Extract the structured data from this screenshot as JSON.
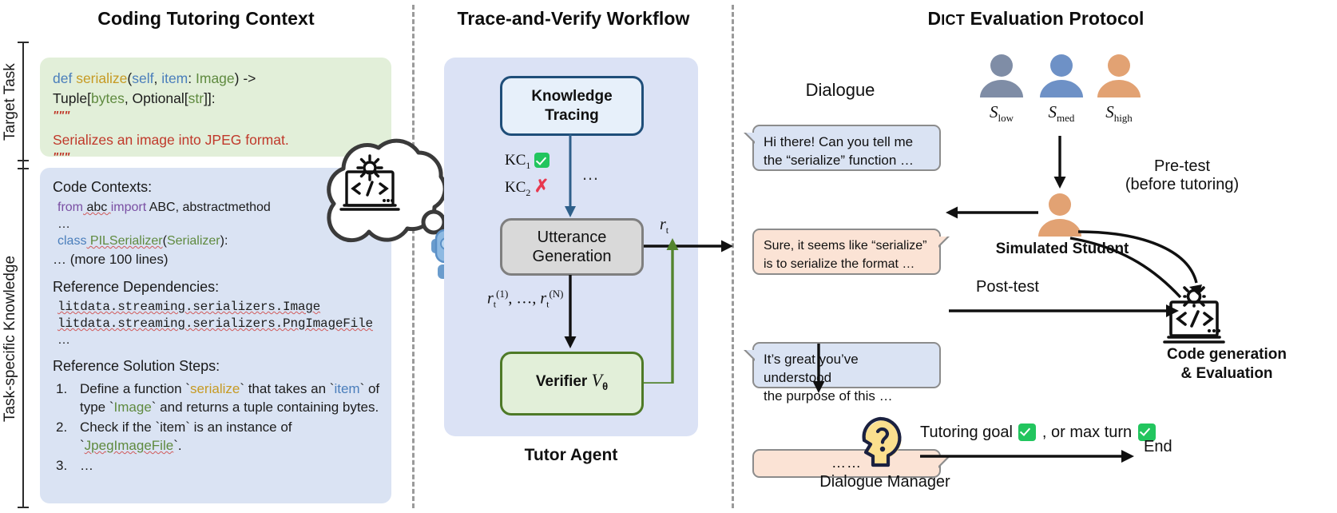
{
  "panels": {
    "left": {
      "title": "Coding Tutoring Context"
    },
    "middle": {
      "title": "Trace-and-Verify Workflow",
      "footer": "Tutor Agent"
    },
    "right": {
      "title_d": "D",
      "title_ict": "ICT",
      "title_rest": " Evaluation Protocol"
    }
  },
  "side_labels": {
    "target_task": "Target Task",
    "task_knowledge": "Task-specific Knowledge"
  },
  "target_task": {
    "line1": {
      "def": "def",
      "fn": "serialize",
      "p1": "(",
      "self": "self",
      "comma": ",  ",
      "item": "item",
      "colon": ": ",
      "image": "Image",
      "p2": ")  ->"
    },
    "line2": {
      "tuple": "Tuple[",
      "bytes": "bytes",
      "sep": ", Optional[",
      "str": "str",
      "end": "]]:"
    },
    "quote_open": "\"\"\"",
    "doc": "Serializes an image into JPEG format.",
    "quote_close": "\"\"\""
  },
  "knowledge": {
    "code_contexts_heading": "Code Contexts:",
    "code_lines": {
      "l1_from": "from",
      "l1_abc": " abc ",
      "l1_import": "import",
      "l1_rest": " ABC, abstractmethod",
      "l2": "…",
      "l3_class": "class",
      "l3_name": " PILSerializer",
      "l3_p1": "(",
      "l3_base": "Serializer",
      "l3_p2": "):",
      "l4": "… (more 100 lines)"
    },
    "ref_deps_heading": "Reference Dependencies:",
    "deps": [
      "litdata.streaming.serializers.Image",
      "litdata.streaming.serializers.PngImageFile",
      "…"
    ],
    "ref_steps_heading": "Reference Solution Steps:",
    "steps": [
      {
        "num": "1.",
        "a": "Define a function `",
        "code1": "serialize",
        "b": "` that takes an `",
        "code2": "item",
        "c": "` of",
        "line2a": "type `",
        "code3": "Image",
        "line2b": "` and returns a tuple containing bytes."
      },
      {
        "num": "2.",
        "a": "Check if the `item` is an instance of `",
        "code1": "JpegImageFile",
        "b": "`."
      },
      {
        "num": "3.",
        "a": "…"
      }
    ]
  },
  "workflow": {
    "knowledge_tracing": {
      "l1": "Knowledge",
      "l2": "Tracing"
    },
    "kc1_label": "KC",
    "kc1_sub": "1",
    "kc2_label": "KC",
    "kc2_sub": "2",
    "ellipsis": "…",
    "utterance_generation": {
      "l1": "Utterance",
      "l2": "Generation"
    },
    "rt_label": "r",
    "rt_sub": "t",
    "candidates": {
      "r": "r",
      "sub": "t",
      "sup1": "(1)",
      "mid": ", …, ",
      "sup2": "(N)"
    },
    "verifier": {
      "text": "Verifier ",
      "v": "V",
      "sub": "θ"
    }
  },
  "dialogue": {
    "heading": "Dialogue",
    "turns": [
      {
        "side": "tutor",
        "l1": "Hi there! Can you tell me",
        "l2": "the “serialize” function …"
      },
      {
        "side": "student",
        "l1": "Sure, it seems like “serialize”",
        "l2": "is to serialize the format …"
      },
      {
        "side": "tutor",
        "l1": "It’s great you’ve understood",
        "l2": "the purpose of this …"
      },
      {
        "side": "student",
        "l1": "……",
        "l2": ""
      }
    ]
  },
  "protocol": {
    "students": [
      {
        "label_s": "S",
        "label_sub": "low",
        "color": "#7f8da6"
      },
      {
        "label_s": "S",
        "label_sub": "med",
        "color": "#6e91c6"
      },
      {
        "label_s": "S",
        "label_sub": "high",
        "color": "#e2a273"
      }
    ],
    "simulated_student": "Simulated Student",
    "pretest_l1": "Pre-test",
    "pretest_l2": "(before tutoring)",
    "posttest": "Post-test",
    "code_gen_l1": "Code generation",
    "code_gen_l2": "& Evaluation",
    "dialogue_manager": "Dialogue Manager",
    "stop_pre": "Tutoring goal",
    "stop_mid": ", or max turn",
    "end": "End"
  },
  "colors": {
    "green_box": "#e2efd9",
    "blue_box": "#dae3f3",
    "agent_bg": "#dbe2f5",
    "kt_border": "#1f4e79",
    "ug_border": "#7f7f7f",
    "vf_border": "#4e7a27",
    "check_green": "#22c55e",
    "x_red": "#e8384f",
    "peach": "#fbe3d5",
    "divider": "#9a9a9a"
  }
}
